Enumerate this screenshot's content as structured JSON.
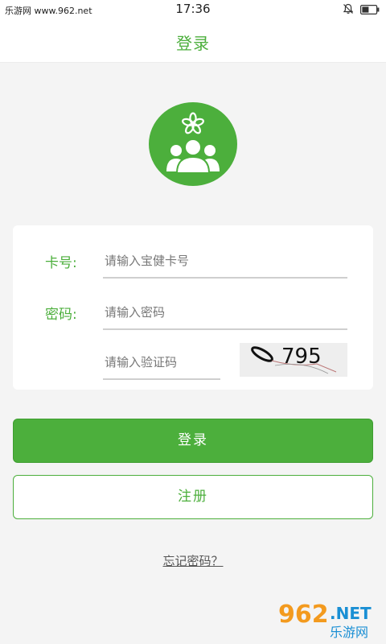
{
  "status_bar": {
    "source": "乐游网 www.962.net",
    "time": "17:36"
  },
  "header": {
    "title": "登录"
  },
  "form": {
    "card_label": "卡号:",
    "card_placeholder": "请输入宝健卡号",
    "password_label": "密码:",
    "password_placeholder": "请输入密码",
    "captcha_placeholder": "请输入验证码",
    "captcha_text": "795"
  },
  "buttons": {
    "login": "登录",
    "register": "注册",
    "forgot": "忘记密码？"
  },
  "watermark": {
    "num": "962",
    "net": ".NET",
    "cn": "乐游网"
  },
  "colors": {
    "accent": "#4caf3c",
    "background": "#f4f4f4"
  },
  "icons": [
    "bell-muted-icon",
    "battery-icon",
    "flower-icon",
    "users-group-icon"
  ]
}
